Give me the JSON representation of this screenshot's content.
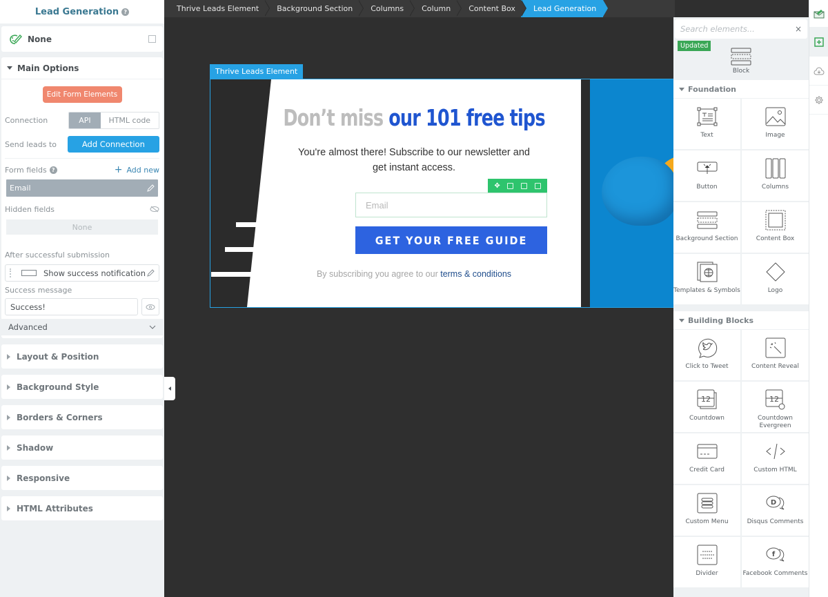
{
  "left_panel": {
    "title": "Lead Generation",
    "help_icon": "question-circle-icon",
    "style_preset": "None",
    "main_options": {
      "title": "Main Options",
      "edit_form_button": "Edit Form Elements",
      "connection_label": "Connection",
      "connection_options": [
        "API",
        "HTML code"
      ],
      "connection_selected": "API",
      "send_leads_label": "Send leads to",
      "add_connection_button": "Add Connection",
      "form_fields_label": "Form fields",
      "add_new_label": "Add new",
      "form_fields": [
        "Email"
      ],
      "hidden_fields_label": "Hidden fields",
      "hidden_fields_value": "None",
      "after_submission_label": "After successful submission",
      "after_submission_action": "Show success notification",
      "success_message_label": "Success message",
      "success_message_value": "Success!",
      "advanced_label": "Advanced"
    },
    "collapsed_sections": [
      "Layout & Position",
      "Background Style",
      "Borders & Corners",
      "Shadow",
      "Responsive",
      "HTML Attributes"
    ]
  },
  "breadcrumb": [
    "Thrive Leads Element",
    "Background Section",
    "Columns",
    "Column",
    "Content Box",
    "Lead Generation"
  ],
  "canvas": {
    "element_tag": "Thrive Leads Element",
    "headline_gray": "Don’t miss",
    "headline_blue": "our 101 free tips",
    "subtext": "You're almost there! Subscribe to our newsletter and get instant access.",
    "email_placeholder": "Email",
    "cta_label": "GET YOUR FREE GUIDE",
    "terms_prefix": "By subscribing you agree to our",
    "terms_link": "terms & conditions",
    "field_toolbar_icons": [
      "move-icon",
      "save-icon",
      "duplicate-icon",
      "delete-icon"
    ],
    "colors": {
      "accent": "#27a2e4",
      "headline_blue": "#1f55d0",
      "cta": "#2d63e0",
      "toolbar_green": "#2ec46d"
    }
  },
  "elements_panel": {
    "search_placeholder": "Search elements...",
    "updated_badge": "Updated",
    "block_label": "Block",
    "groups": [
      {
        "title": "Foundation",
        "items": [
          "Text",
          "Image",
          "Button",
          "Columns",
          "Background Section",
          "Content Box",
          "Templates & Symbols",
          "Logo"
        ]
      },
      {
        "title": "Building Blocks",
        "items": [
          "Click to Tweet",
          "Content Reveal",
          "Countdown",
          "Countdown Evergreen",
          "Credit Card",
          "Custom HTML",
          "Custom Menu",
          "Disqus Comments",
          "Divider",
          "Facebook Comments"
        ]
      }
    ]
  },
  "right_sidebar": [
    "lead-generation-icon",
    "add-element-icon",
    "cloud-download-icon",
    "settings-gear-icon"
  ]
}
